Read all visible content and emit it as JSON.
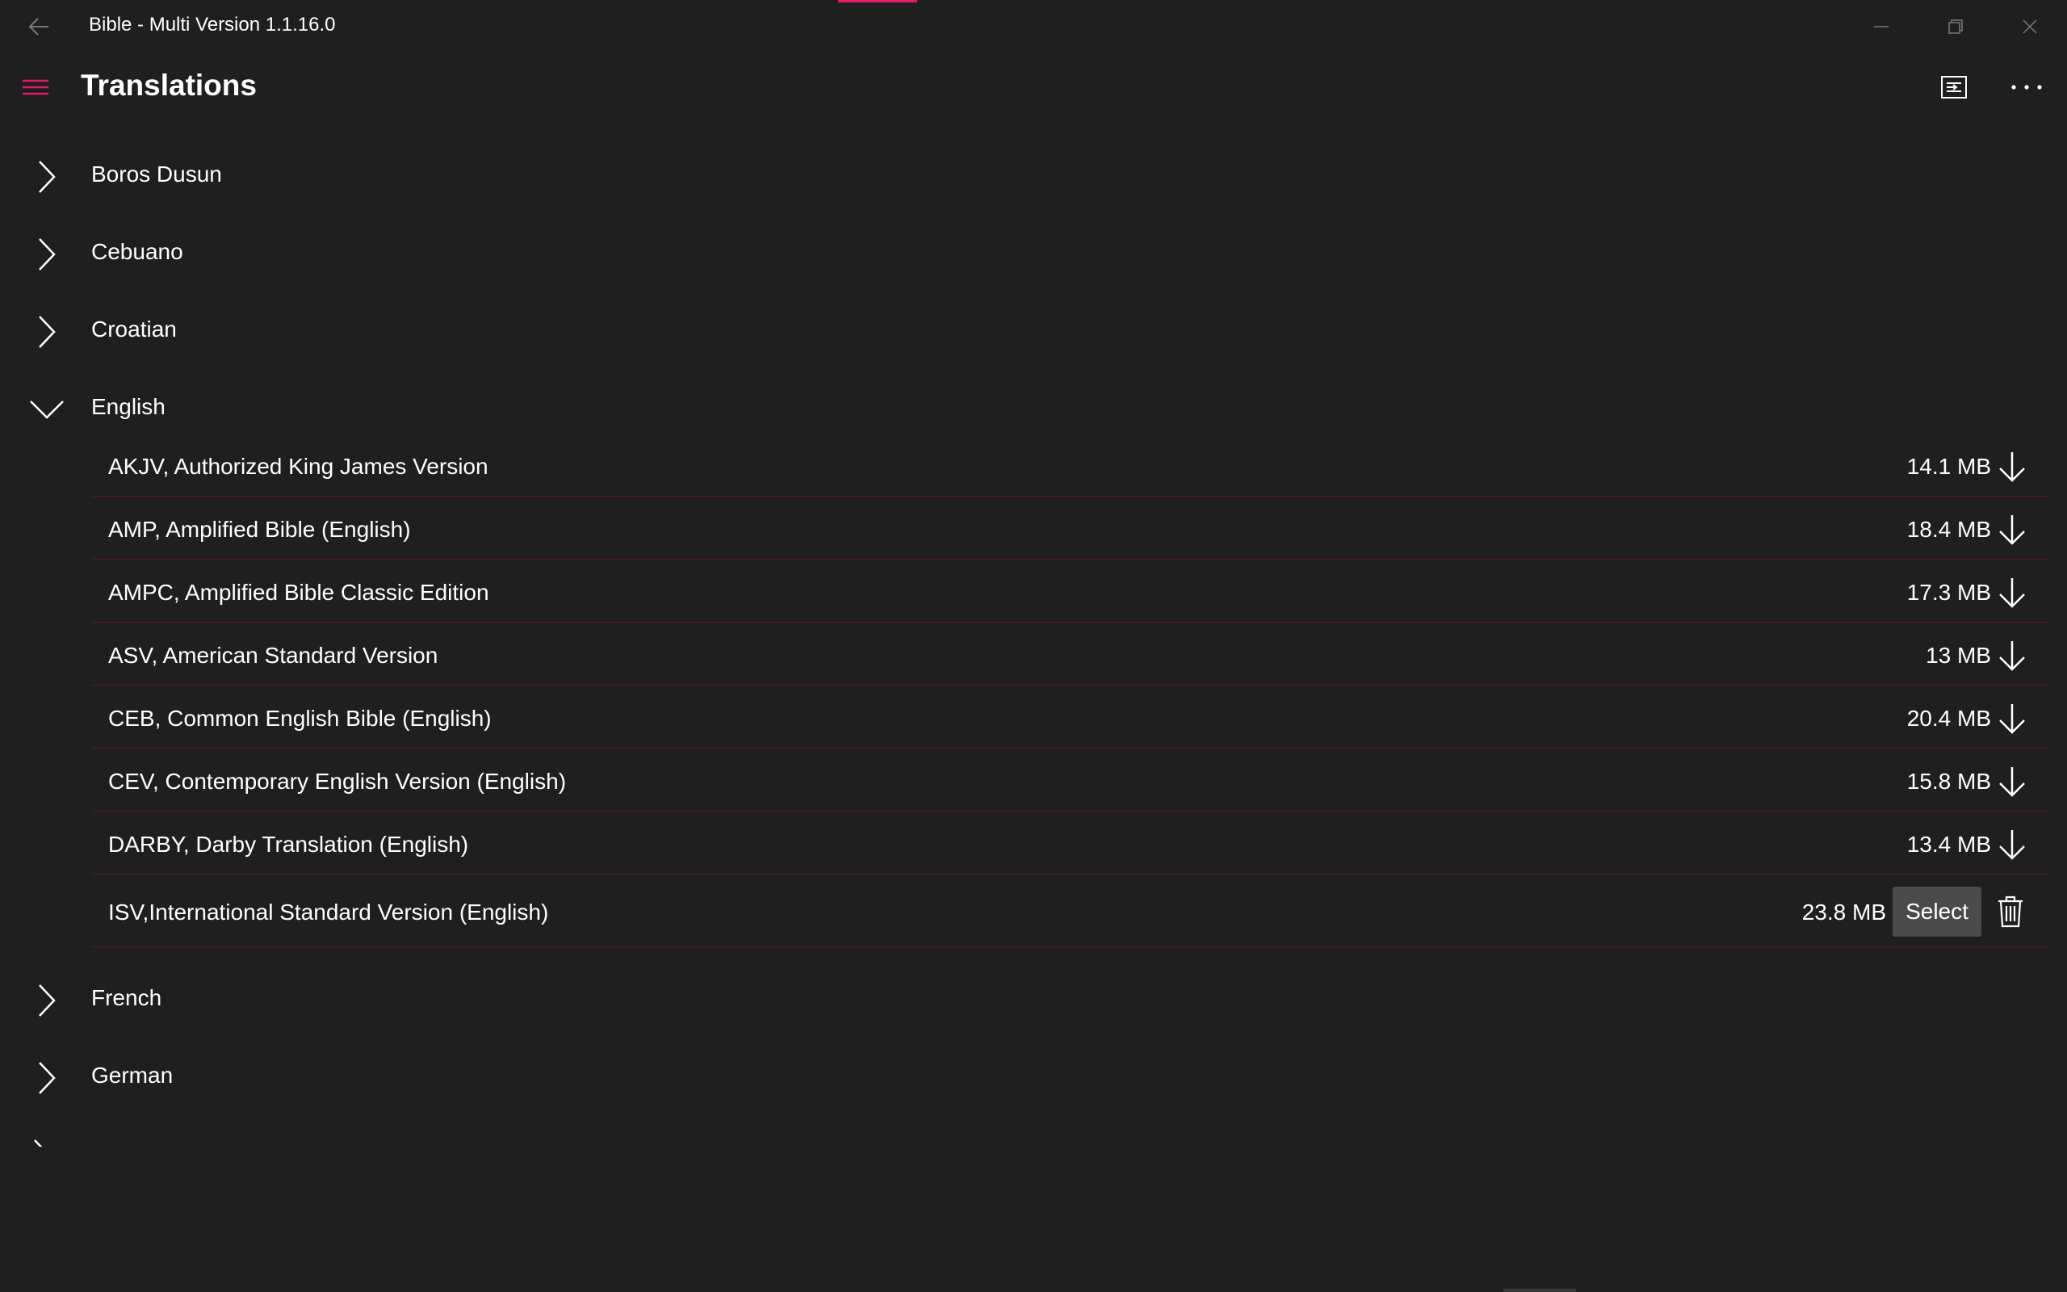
{
  "window": {
    "title": "Bible - Multi Version 1.1.16.0",
    "back_icon": "back-arrow-icon",
    "accent_color": "#e3196a"
  },
  "header": {
    "title": "Translations",
    "menu_icon": "hamburger-icon",
    "import_icon": "import-icon",
    "more_icon": "more-icon"
  },
  "groups": [
    {
      "label": "Boros Dusun",
      "expanded": false
    },
    {
      "label": "Cebuano",
      "expanded": false
    },
    {
      "label": "Croatian",
      "expanded": false
    },
    {
      "label": "English",
      "expanded": true
    },
    {
      "label": "French",
      "expanded": false
    },
    {
      "label": "German",
      "expanded": false
    }
  ],
  "english_translations": [
    {
      "name": "AKJV, Authorized King James Version",
      "size": "14.1 MB",
      "action": "download"
    },
    {
      "name": "AMP, Amplified Bible (English)",
      "size": "18.4 MB",
      "action": "download"
    },
    {
      "name": "AMPC, Amplified Bible Classic Edition",
      "size": "17.3 MB",
      "action": "download"
    },
    {
      "name": "ASV, American Standard Version",
      "size": "13 MB",
      "action": "download"
    },
    {
      "name": "CEB, Common English Bible (English)",
      "size": "20.4 MB",
      "action": "download"
    },
    {
      "name": "CEV, Contemporary English Version (English)",
      "size": "15.8 MB",
      "action": "download"
    },
    {
      "name": "DARBY, Darby Translation (English)",
      "size": "13.4 MB",
      "action": "download"
    },
    {
      "name": "ISV,International Standard Version (English)",
      "size": "23.8 MB",
      "action": "installed",
      "select_label": "Select"
    }
  ],
  "colors": {
    "background": "#1f1f1f",
    "accent": "#e3196a",
    "divider": "#5e1530",
    "select_button": "#4a4a4a"
  }
}
